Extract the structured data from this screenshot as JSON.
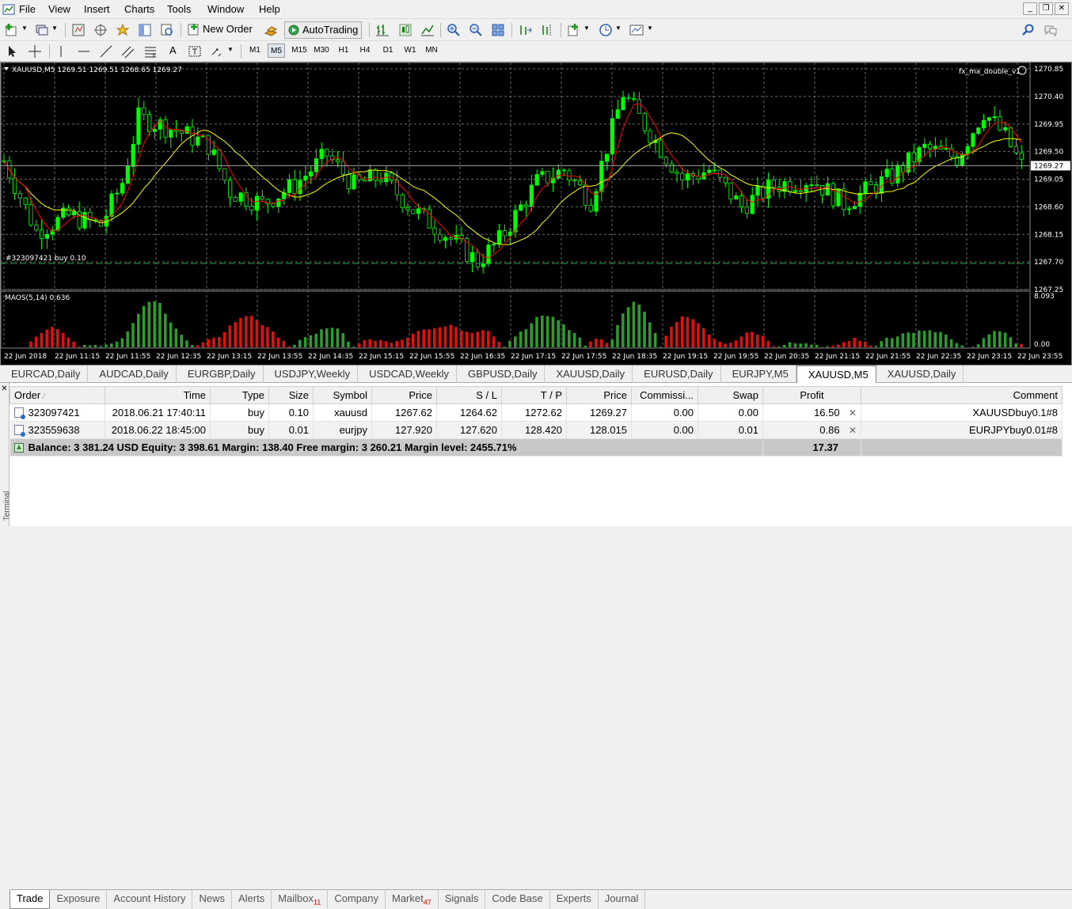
{
  "menu": [
    "File",
    "View",
    "Insert",
    "Charts",
    "Tools",
    "Window",
    "Help"
  ],
  "toolbar": {
    "new_order": "New Order",
    "autotrading": "AutoTrading",
    "timeframes": [
      "M1",
      "M5",
      "M15",
      "M30",
      "H1",
      "H4",
      "D1",
      "W1",
      "MN"
    ],
    "active_timeframe": "M5",
    "text_tool": "A"
  },
  "chart": {
    "header": "XAUUSD,M5  1269.51 1269.51 1268.65 1269.27",
    "ea_label": "fx_ma_double_v1",
    "order_line_label": "#323097421 buy 0.10",
    "price_ticks": [
      "1270.85",
      "1270.40",
      "1269.95",
      "1269.50",
      "1269.05",
      "1268.60",
      "1268.15",
      "1267.70",
      "1267.25"
    ],
    "current_price": "1269.27",
    "indicator_label": "MAOS(5,14) 0.636",
    "indicator_ticks": [
      "8.093",
      "0.00"
    ],
    "indicator_last": "0.636",
    "time_ticks": [
      "22 Jun 2018",
      "22 Jun 11:15",
      "22 Jun 11:55",
      "22 Jun 12:35",
      "22 Jun 13:15",
      "22 Jun 13:55",
      "22 Jun 14:35",
      "22 Jun 15:15",
      "22 Jun 15:55",
      "22 Jun 16:35",
      "22 Jun 17:15",
      "22 Jun 17:55",
      "22 Jun 18:35",
      "22 Jun 19:15",
      "22 Jun 19:55",
      "22 Jun 20:35",
      "22 Jun 21:15",
      "22 Jun 21:55",
      "22 Jun 22:35",
      "22 Jun 23:15",
      "22 Jun 23:55"
    ],
    "colors": {
      "bull": "#00ff00",
      "bear": "#000000",
      "wick": "#00ff00",
      "ma_fast": "#ff0000",
      "ma_slow": "#ffff00",
      "grid": "#6a6a6a",
      "ind_up": "#2e9b2e",
      "ind_down": "#e01010"
    }
  },
  "chart_tabs": [
    "EURCAD,Daily",
    "AUDCAD,Daily",
    "EURGBP,Daily",
    "USDJPY,Weekly",
    "USDCAD,Weekly",
    "GBPUSD,Daily",
    "XAUUSD,Daily",
    "EURUSD,Daily",
    "EURJPY,M5",
    "XAUUSD,M5",
    "XAUUSD,Daily"
  ],
  "active_chart_tab": "XAUUSD,M5",
  "terminal": {
    "side_label": "Terminal",
    "columns": [
      "Order",
      "Time",
      "Type",
      "Size",
      "Symbol",
      "Price",
      "S / L",
      "T / P",
      "Price",
      "Commissi...",
      "Swap",
      "Profit",
      "Comment"
    ],
    "rows": [
      [
        "323097421",
        "2018.06.21 17:40:11",
        "buy",
        "0.10",
        "xauusd",
        "1267.62",
        "1264.62",
        "1272.62",
        "1269.27",
        "0.00",
        "0.00",
        "16.50",
        "XAUUSDbuy0.1#8"
      ],
      [
        "323559638",
        "2018.06.22 18:45:00",
        "buy",
        "0.01",
        "eurjpy",
        "127.920",
        "127.620",
        "128.420",
        "128.015",
        "0.00",
        "0.01",
        "0.86",
        "EURJPYbuy0.01#8"
      ]
    ],
    "summary": "Balance: 3 381.24 USD  Equity: 3 398.61  Margin: 138.40  Free margin: 3 260.21  Margin level: 2455.71%",
    "summary_profit": "17.37",
    "close_glyph": "✕"
  },
  "bottom_tabs": [
    {
      "label": "Trade",
      "badge": ""
    },
    {
      "label": "Exposure",
      "badge": ""
    },
    {
      "label": "Account History",
      "badge": ""
    },
    {
      "label": "News",
      "badge": ""
    },
    {
      "label": "Alerts",
      "badge": ""
    },
    {
      "label": "Mailbox",
      "badge": "11"
    },
    {
      "label": "Company",
      "badge": ""
    },
    {
      "label": "Market",
      "badge": "47"
    },
    {
      "label": "Signals",
      "badge": ""
    },
    {
      "label": "Code Base",
      "badge": ""
    },
    {
      "label": "Experts",
      "badge": ""
    },
    {
      "label": "Journal",
      "badge": ""
    }
  ],
  "active_bottom_tab": "Trade"
}
